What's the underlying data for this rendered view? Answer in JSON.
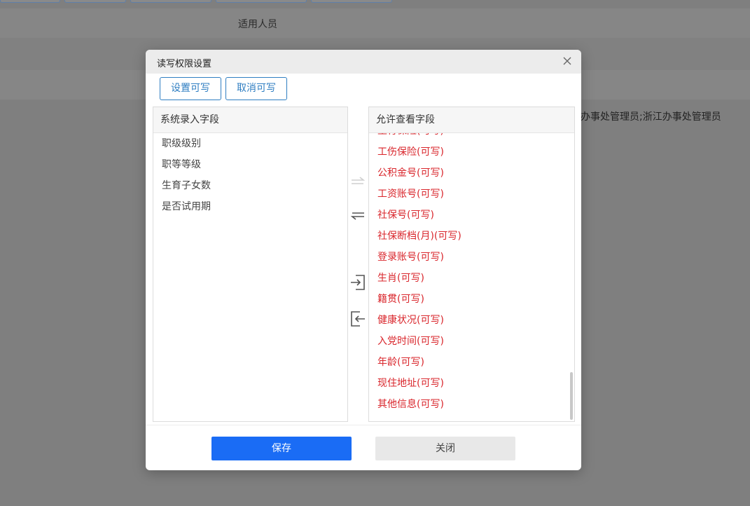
{
  "background": {
    "header_label": "适用人员",
    "row_text": "办事处管理员;浙江办事处管理员"
  },
  "dialog": {
    "title": "读写权限设置",
    "set_writable_label": "设置可写",
    "cancel_writable_label": "取消可写",
    "left_panel": {
      "title": "系统录入字段",
      "items": [
        "职级级别",
        "职等等级",
        "生育子女数",
        "是否试用期"
      ]
    },
    "right_panel": {
      "title": "允许查看字段",
      "items": [
        "生育保险(可写)",
        "工伤保险(可写)",
        "公积金号(可写)",
        "工资账号(可写)",
        "社保号(可写)",
        "社保断档(月)(可写)",
        "登录账号(可写)",
        "生肖(可写)",
        "籍贯(可写)",
        "健康状况(可写)",
        "入党时间(可写)",
        "年龄(可写)",
        "现住地址(可写)",
        "其他信息(可写)"
      ]
    },
    "save_label": "保存",
    "close_label": "关闭"
  },
  "colors": {
    "primary": "#1a6cf5",
    "outline": "#2f7ec2",
    "writable_item": "#d9252b"
  },
  "icons": [
    "close-icon",
    "move-right-arrow-icon",
    "move-left-arrow-icon",
    "move-all-right-icon",
    "move-all-left-icon"
  ]
}
